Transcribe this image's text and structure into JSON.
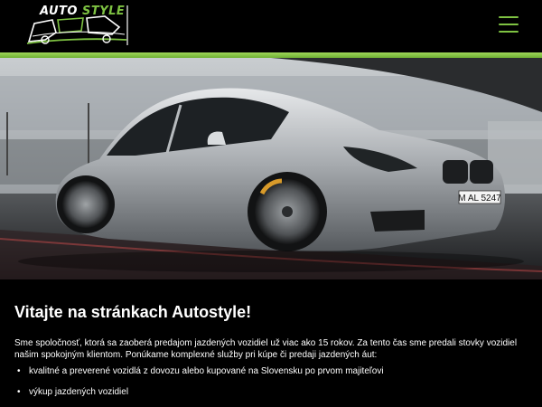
{
  "header": {
    "logo": {
      "word1": "AUTO",
      "word2": "STYLE"
    },
    "menu_icon": "hamburger-menu-icon",
    "accent": "#7ec242"
  },
  "hero": {
    "image": "silver-sedan-racetrack",
    "plate": "M AL 5247"
  },
  "intro": {
    "title": "Vitajte na stránkach Autostyle!",
    "paragraph": "Sme spoločnosť, ktorá sa zaoberá predajom jazdených vozidiel už viac ako 15 rokov. Za tento čas sme predali stovky vozidiel našim spokojným klientom. Ponúkame komplexné služby pri kúpe či predaji jazdených áut:",
    "services": [
      "kvalitné a preverené vozidlá z dovozu alebo kupované na Slovensku po prvom majiteľovi",
      "výkup jazdených vozidiel"
    ]
  }
}
